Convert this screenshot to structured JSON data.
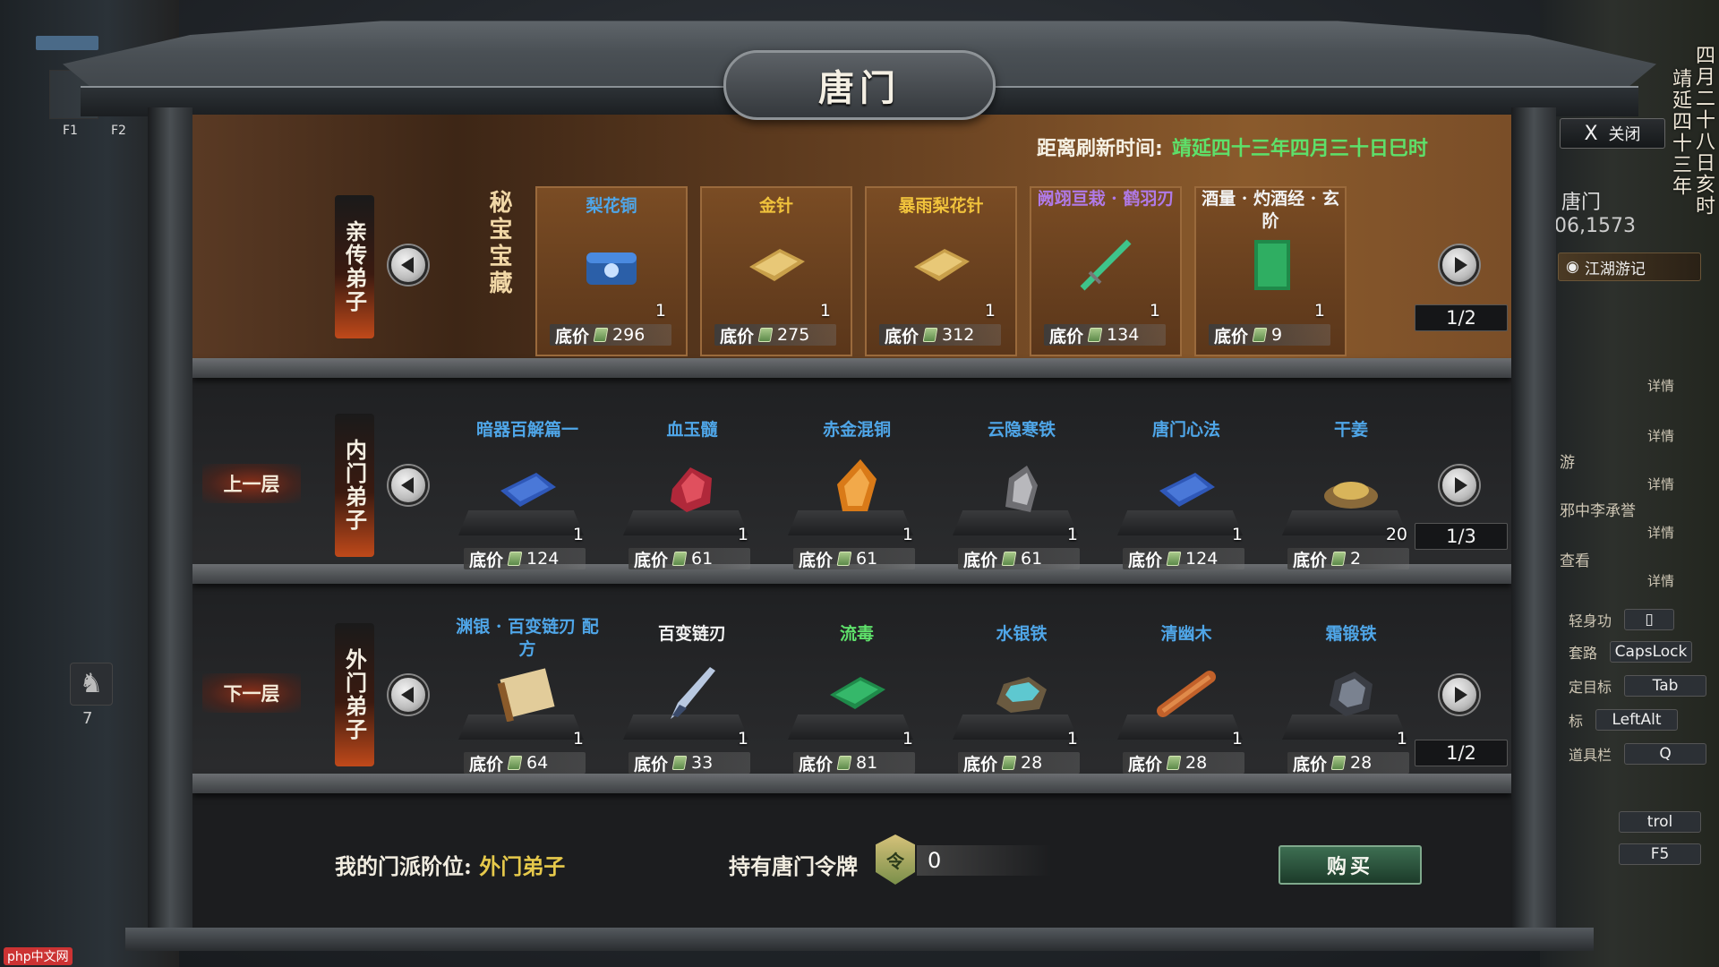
{
  "window": {
    "title": "唐门"
  },
  "hud": {
    "f1": "F1",
    "f2": "F2",
    "mount_count": "7",
    "date_col1": "四月二十八日亥时",
    "date_col2": "靖延四十三年",
    "close_x": "X",
    "close_label": "关闭",
    "location": "唐门",
    "coords": "06,1573",
    "journal": "江湖游记",
    "details": [
      "详情",
      "详情",
      "详情",
      "详情",
      "详情"
    ],
    "side_texts": [
      "游",
      "邪中李承誉",
      "查看"
    ],
    "keys": [
      {
        "label": "轻身功",
        "key": ""
      },
      {
        "label": "套路",
        "key": "CapsLock"
      },
      {
        "label": "定目标",
        "key": "Tab"
      },
      {
        "label": "标",
        "key": "LeftAlt"
      },
      {
        "label": "道具栏",
        "key": "Q"
      }
    ],
    "key_extra1": "trol",
    "key_extra2": "F5",
    "watermark": "php中文网"
  },
  "refresh": {
    "label": "距离刷新时间:",
    "value": "靖延四十三年四月三十日巳时"
  },
  "shelves": [
    {
      "rank": "亲传弟子",
      "side_label": "秘宝宝藏",
      "pager": "1/2",
      "items": [
        {
          "name": "梨花铜",
          "color": "#4fa6e8",
          "qty": "1",
          "price": "296",
          "icon": "blue-box-icon"
        },
        {
          "name": "金针",
          "color": "#f0c23c",
          "qty": "1",
          "price": "275",
          "icon": "gold-scroll-icon"
        },
        {
          "name": "暴雨梨花针",
          "color": "#f0c23c",
          "qty": "1",
          "price": "312",
          "icon": "gold-scroll-icon"
        },
        {
          "name": "阙翊亘栽 · 鹤羽刃",
          "color": "#b07ae8",
          "qty": "1",
          "price": "134",
          "icon": "green-sword-icon"
        },
        {
          "name": "酒量 · 灼酒经 · 玄阶",
          "color": "#f2f2f2",
          "qty": "1",
          "price": "9",
          "icon": "green-book-icon"
        }
      ]
    },
    {
      "rank": "内门弟子",
      "floor_label": "上一层",
      "pager": "1/3",
      "items": [
        {
          "name": "暗器百解篇一",
          "color": "#4fa6e8",
          "qty": "1",
          "price": "124",
          "icon": "blue-book-icon"
        },
        {
          "name": "血玉髓",
          "color": "#4fa6e8",
          "qty": "1",
          "price": "61",
          "icon": "red-gem-icon"
        },
        {
          "name": "赤金混铜",
          "color": "#4fa6e8",
          "qty": "1",
          "price": "61",
          "icon": "amber-crystal-icon"
        },
        {
          "name": "云隐寒铁",
          "color": "#4fa6e8",
          "qty": "1",
          "price": "61",
          "icon": "grey-ore-icon"
        },
        {
          "name": "唐门心法",
          "color": "#4fa6e8",
          "qty": "1",
          "price": "124",
          "icon": "blue-book-icon"
        },
        {
          "name": "干姜",
          "color": "#4fa6e8",
          "qty": "20",
          "price": "2",
          "icon": "herb-pile-icon"
        }
      ]
    },
    {
      "rank": "外门弟子",
      "floor_label": "下一层",
      "pager": "1/2",
      "items": [
        {
          "name": "渊银 · 百变链刃 配方",
          "color": "#4fa6e8",
          "qty": "1",
          "price": "64",
          "icon": "scroll-icon"
        },
        {
          "name": "百变链刃",
          "color": "#f2f2f2",
          "qty": "1",
          "price": "33",
          "icon": "chain-blade-icon"
        },
        {
          "name": "流毒",
          "color": "#5ee06a",
          "qty": "1",
          "price": "81",
          "icon": "green-book-icon"
        },
        {
          "name": "水银铁",
          "color": "#4fa6e8",
          "qty": "1",
          "price": "28",
          "icon": "blue-ore-icon"
        },
        {
          "name": "清幽木",
          "color": "#4fa6e8",
          "qty": "1",
          "price": "28",
          "icon": "wood-log-icon"
        },
        {
          "name": "霜锻铁",
          "color": "#4fa6e8",
          "qty": "1",
          "price": "28",
          "icon": "dark-ore-icon"
        }
      ]
    }
  ],
  "price_label": "底价",
  "footer": {
    "rank_label": "我的门派阶位:",
    "rank_value": "外门弟子",
    "token_label": "持有唐门令牌",
    "token_badge": "令",
    "token_count": "0",
    "buy_label": "购买"
  }
}
